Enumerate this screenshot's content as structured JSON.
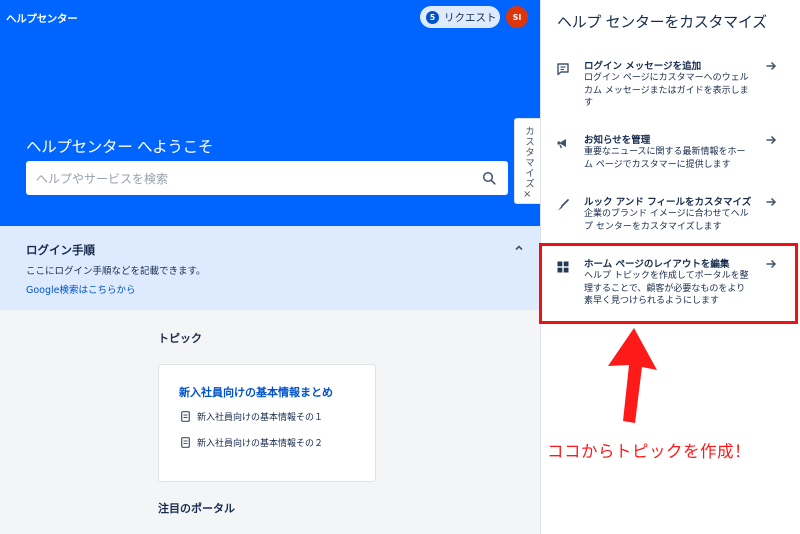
{
  "header": {
    "brand": "ヘルプセンター",
    "request_count": "5",
    "request_label": "リクエスト",
    "avatar_initials": "SI"
  },
  "hero": {
    "welcome": "ヘルプセンター へようこそ",
    "search_placeholder": "ヘルプやサービスを検索"
  },
  "login_box": {
    "title": "ログイン手順",
    "description": "ここにログイン手順などを記載できます。",
    "link": "Google検索はこちらから"
  },
  "topics": {
    "heading": "トピック",
    "card_title": "新入社員向けの基本情報まとめ",
    "items": [
      "新入社員向けの基本情報その１",
      "新入社員向けの基本情報その２"
    ]
  },
  "featured": {
    "heading": "注目のポータル"
  },
  "customize_tab": {
    "label": "カスタマイズ",
    "close": "×"
  },
  "panel": {
    "title": "ヘルプ センターをカスタマイズ",
    "options": [
      {
        "icon": "comment-icon",
        "title": "ログイン メッセージを追加",
        "desc": "ログイン ページにカスタマーへのウェルカム メッセージまたはガイドを表示します"
      },
      {
        "icon": "megaphone-icon",
        "title": "お知らせを管理",
        "desc": "重要なニュースに関する最新情報をホーム ページでカスタマーに提供します"
      },
      {
        "icon": "brush-icon",
        "title": "ルック アンド フィールをカスタマイズ",
        "desc": "企業のブランド イメージに合わせてヘルプ センターをカスタマイズします"
      },
      {
        "icon": "layout-grid-icon",
        "title": "ホーム ページのレイアウトを編集",
        "desc": "ヘルプ トピックを作成してポータルを整理することで、顧客が必要なものをより素早く見つけられるようにします"
      }
    ]
  },
  "annotation": {
    "callout": "ココからトピックを作成！",
    "color": "#ff1a1a"
  },
  "colors": {
    "brand_blue": "#0065ff",
    "link": "#0052cc",
    "info_bg": "#deebff"
  }
}
